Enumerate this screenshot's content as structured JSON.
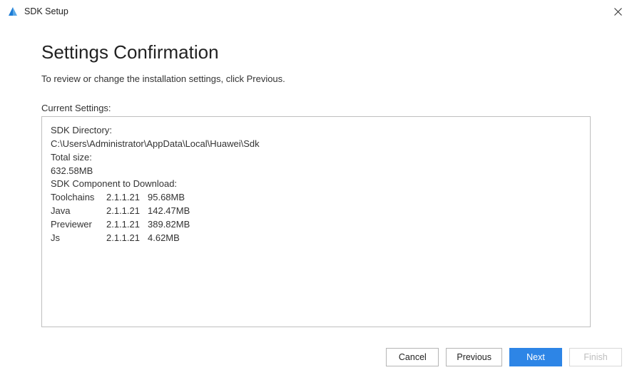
{
  "window": {
    "title": "SDK Setup"
  },
  "page": {
    "heading": "Settings Confirmation",
    "subtext": "To review or change the installation settings, click Previous.",
    "settings_label": "Current Settings:"
  },
  "settings": {
    "sdk_dir_label": "SDK Directory:",
    "sdk_dir_path": "C:\\Users\\Administrator\\AppData\\Local\\Huawei\\Sdk",
    "total_size_label": "Total size:",
    "total_size_value": "632.58MB",
    "components_label": "SDK Component to Download:",
    "components": [
      {
        "name": "Toolchains",
        "version": "2.1.1.21",
        "size": "95.68MB"
      },
      {
        "name": "Java",
        "version": "2.1.1.21",
        "size": "142.47MB"
      },
      {
        "name": "Previewer",
        "version": "2.1.1.21",
        "size": "389.82MB"
      },
      {
        "name": "Js",
        "version": "2.1.1.21",
        "size": "4.62MB"
      }
    ]
  },
  "buttons": {
    "cancel": "Cancel",
    "previous": "Previous",
    "next": "Next",
    "finish": "Finish"
  }
}
